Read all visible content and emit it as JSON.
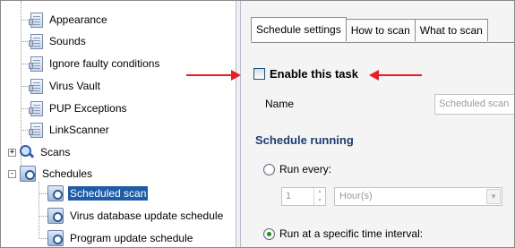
{
  "tree": {
    "items": [
      {
        "label": "Appearance",
        "icon": "page-icon"
      },
      {
        "label": "Sounds",
        "icon": "page-icon"
      },
      {
        "label": "Ignore faulty conditions",
        "icon": "page-icon"
      },
      {
        "label": "Virus Vault",
        "icon": "page-icon"
      },
      {
        "label": "PUP Exceptions",
        "icon": "page-icon"
      },
      {
        "label": "LinkScanner",
        "icon": "page-icon"
      },
      {
        "label": "Scans",
        "icon": "magnifier-icon",
        "expander": "+"
      },
      {
        "label": "Schedules",
        "icon": "schedule-icon",
        "expander": "-"
      },
      {
        "label": "Scheduled scan",
        "icon": "schedule-icon",
        "selected": true
      },
      {
        "label": "Virus database update schedule",
        "icon": "schedule-icon"
      },
      {
        "label": "Program update schedule",
        "icon": "schedule-icon"
      }
    ]
  },
  "tabs": [
    {
      "label": "Schedule settings",
      "active": true
    },
    {
      "label": "How to scan",
      "active": false
    },
    {
      "label": "What to scan",
      "active": false
    }
  ],
  "settings": {
    "enable_task_label": "Enable this task",
    "enable_task_checked": false,
    "name_label": "Name",
    "name_value": "Scheduled scan",
    "section_title": "Schedule running",
    "run_every_label": "Run every:",
    "run_every_value": "1",
    "run_every_unit": "Hour(s)",
    "run_specific_label": "Run at a specific time interval:"
  },
  "colors": {
    "selection": "#1f5ca8",
    "annotation_arrow": "#ea1c24",
    "section_title": "#1d3d72"
  }
}
